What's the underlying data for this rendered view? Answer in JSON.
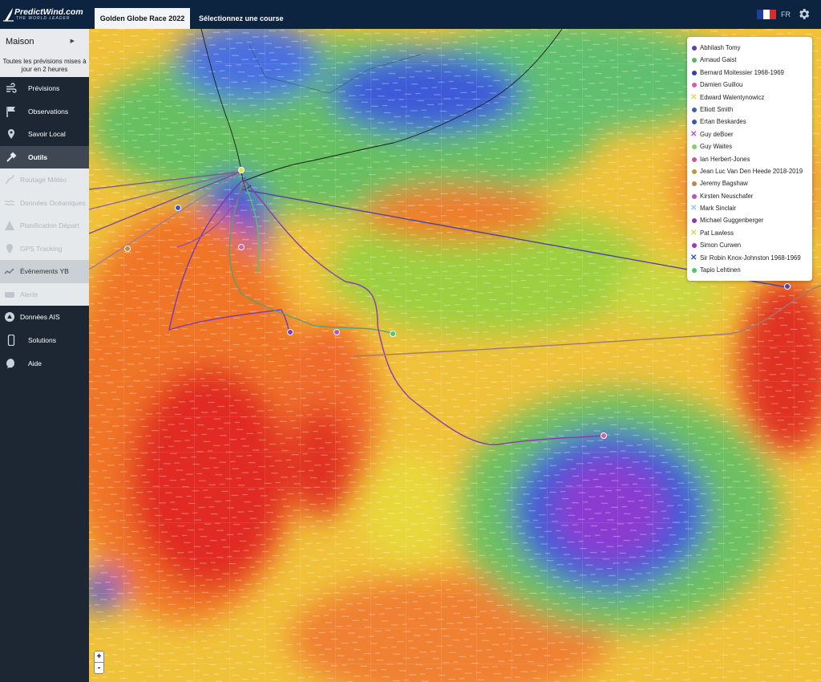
{
  "header": {
    "logo_text": "PredictWind.com",
    "logo_tagline": "THE WORLD LEADER",
    "active_tab": "Golden Globe Race 2022",
    "course_tab": "Sélectionnez une course",
    "language": "FR"
  },
  "sidebar": {
    "home_label": "Maison",
    "update_note": "Toutes les prévisions mises à jour en 2 heures",
    "items": [
      {
        "label": "Prévisions",
        "icon": "wind-icon",
        "state": "dark"
      },
      {
        "label": "Observations",
        "icon": "flag-icon",
        "state": "dark"
      },
      {
        "label": "Savoir Local",
        "icon": "map-pin-icon",
        "state": "dark"
      },
      {
        "label": "Outils",
        "icon": "tools-icon",
        "state": "selected"
      },
      {
        "label": "Routage Météo",
        "icon": "route-icon",
        "state": "disabled"
      },
      {
        "label": "Données Océaniques",
        "icon": "waves-icon",
        "state": "disabled"
      },
      {
        "label": "Planification Départ",
        "icon": "warning-icon",
        "state": "disabled"
      },
      {
        "label": "GPS Tracking",
        "icon": "location-icon",
        "state": "disabled"
      },
      {
        "label": "Évènements YB",
        "icon": "event-icon",
        "state": "light"
      },
      {
        "label": "Alerte",
        "icon": "alert-icon",
        "state": "disabled"
      },
      {
        "label": "Données AIS",
        "icon": "ais-icon",
        "state": "dark"
      },
      {
        "label": "Solutions",
        "icon": "phone-icon",
        "state": "dark"
      },
      {
        "label": "Aide",
        "icon": "help-icon",
        "state": "dark"
      }
    ]
  },
  "legend": [
    {
      "name": "Abhilash Tomy",
      "color": "#5b3fb0",
      "marker": "dot"
    },
    {
      "name": "Arnaud Gaist",
      "color": "#55b56a",
      "marker": "dot"
    },
    {
      "name": "Bernard Moitessier 1968-1969",
      "color": "#3a3ab0",
      "marker": "dot"
    },
    {
      "name": "Damien Guillou",
      "color": "#d95ab0",
      "marker": "dot"
    },
    {
      "name": "Edward Walentynowicz",
      "color": "#d8dc4a",
      "marker": "x"
    },
    {
      "name": "Elliott Smith",
      "color": "#3e63a8",
      "marker": "dot"
    },
    {
      "name": "Ertan Beskardes",
      "color": "#3a55c0",
      "marker": "dot"
    },
    {
      "name": "Guy deBoer",
      "color": "#c84ad8",
      "marker": "x"
    },
    {
      "name": "Guy Waites",
      "color": "#7ed06a",
      "marker": "dot"
    },
    {
      "name": "Ian Herbert-Jones",
      "color": "#c65a8e",
      "marker": "dot"
    },
    {
      "name": "Jean Luc Van Den Heede 2018-2019",
      "color": "#b59a3c",
      "marker": "dot"
    },
    {
      "name": "Jeremy Bagshaw",
      "color": "#c2873a",
      "marker": "dot"
    },
    {
      "name": "Kirsten Neuschafer",
      "color": "#c050b8",
      "marker": "dot"
    },
    {
      "name": "Mark Sinclair",
      "color": "#8ec8e8",
      "marker": "x"
    },
    {
      "name": "Michael Guggenberger",
      "color": "#8a3ab8",
      "marker": "dot"
    },
    {
      "name": "Pat Lawless",
      "color": "#d8d84a",
      "marker": "x"
    },
    {
      "name": "Simon Curwen",
      "color": "#9a3ab0",
      "marker": "dot"
    },
    {
      "name": "Sir Robin Knox-Johnston 1968-1969",
      "color": "#2a5ab8",
      "marker": "x"
    },
    {
      "name": "Tapio Lehtinen",
      "color": "#4ac870",
      "marker": "dot"
    }
  ],
  "zoom": {
    "in": "+",
    "out": "-"
  }
}
